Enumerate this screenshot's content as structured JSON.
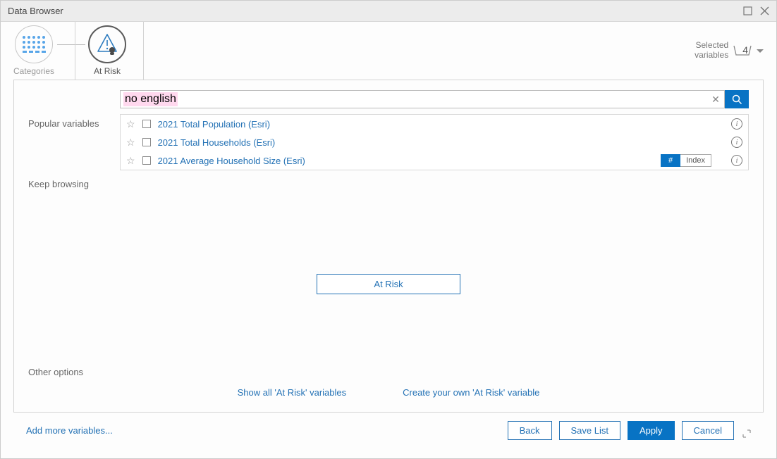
{
  "window": {
    "title": "Data Browser"
  },
  "nav": {
    "step1_label": "Categories",
    "step2_label": "At Risk"
  },
  "selected_variables": {
    "label_line1": "Selected",
    "label_line2": "variables",
    "count": "4"
  },
  "search": {
    "value": "no english"
  },
  "sections": {
    "popular_label": "Popular variables",
    "keep_browsing_label": "Keep browsing",
    "other_options_label": "Other options"
  },
  "popular_vars": [
    {
      "label": "2021 Total Population (Esri)"
    },
    {
      "label": "2021 Total Households (Esri)"
    },
    {
      "label": "2021 Average Household Size (Esri)",
      "badge_num": "#",
      "badge_index": "Index"
    }
  ],
  "center_button": {
    "label": "At Risk"
  },
  "other_links": {
    "show_all": "Show all 'At Risk' variables",
    "create_own": "Create your own 'At Risk' variable"
  },
  "footer": {
    "add_more": "Add more variables...",
    "back": "Back",
    "save_list": "Save List",
    "apply": "Apply",
    "cancel": "Cancel"
  }
}
